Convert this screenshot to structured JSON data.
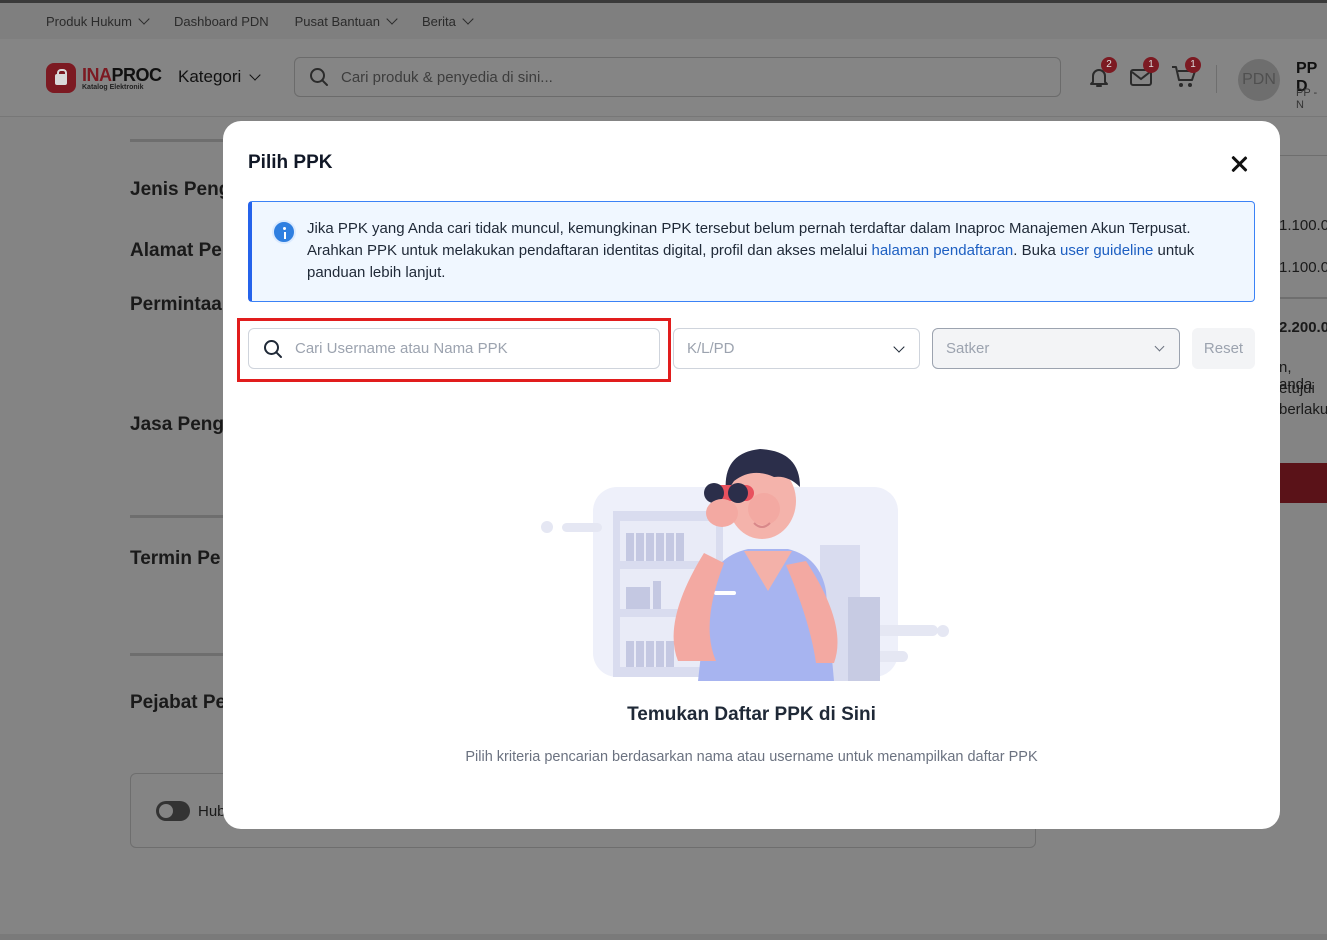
{
  "topnav": {
    "items": [
      {
        "label": "Produk Hukum",
        "has_dropdown": true
      },
      {
        "label": "Dashboard PDN",
        "has_dropdown": false
      },
      {
        "label": "Pusat Bantuan",
        "has_dropdown": true
      },
      {
        "label": "Berita",
        "has_dropdown": true
      }
    ]
  },
  "header": {
    "logo_name_red": "INA",
    "logo_name_dark": "PROC",
    "logo_sub": "Katalog Elektronik",
    "kategori_label": "Kategori",
    "search_placeholder": "Cari produk & penyedia di sini...",
    "notifications_count": "2",
    "messages_count": "1",
    "cart_count": "1",
    "avatar_initials": "PDN",
    "user_name": "PP D",
    "user_sub": "PP - N"
  },
  "background": {
    "headings": [
      "Jenis Peng",
      "Alamat Pe",
      "Permintaa",
      "Jasa Pengi",
      "Termin Pe",
      "Pejabat Pe"
    ],
    "toggle_label": "Hub",
    "right_values": [
      "1.100.0",
      "1.100.0",
      "2.200.0",
      "n, anda",
      "etujui",
      "berlaku"
    ]
  },
  "modal": {
    "title": "Pilih PPK",
    "info": {
      "text_1": "Jika PPK yang Anda cari tidak muncul, kemungkinan PPK tersebut belum pernah terdaftar dalam Inaproc Manajemen Akun Terpusat. Arahkan PPK untuk melakukan pendaftaran identitas digital, profil dan akses melalui ",
      "link_1": "halaman pendaftaran",
      "text_2": ". Buka ",
      "link_2": "user guideline",
      "text_3": " untuk panduan lebih lanjut."
    },
    "filters": {
      "search_placeholder": "Cari Username atau Nama PPK",
      "klpd_placeholder": "K/L/PD",
      "satker_placeholder": "Satker",
      "reset_label": "Reset"
    },
    "empty_state": {
      "title": "Temukan Daftar PPK di Sini",
      "description": "Pilih kriteria pencarian berdasarkan nama atau username untuk menampilkan daftar PPK"
    }
  },
  "colors": {
    "brand": "#d21f3c",
    "info_border": "#2563eb",
    "highlight": "#e11d1d",
    "link": "#1d5fc2"
  }
}
